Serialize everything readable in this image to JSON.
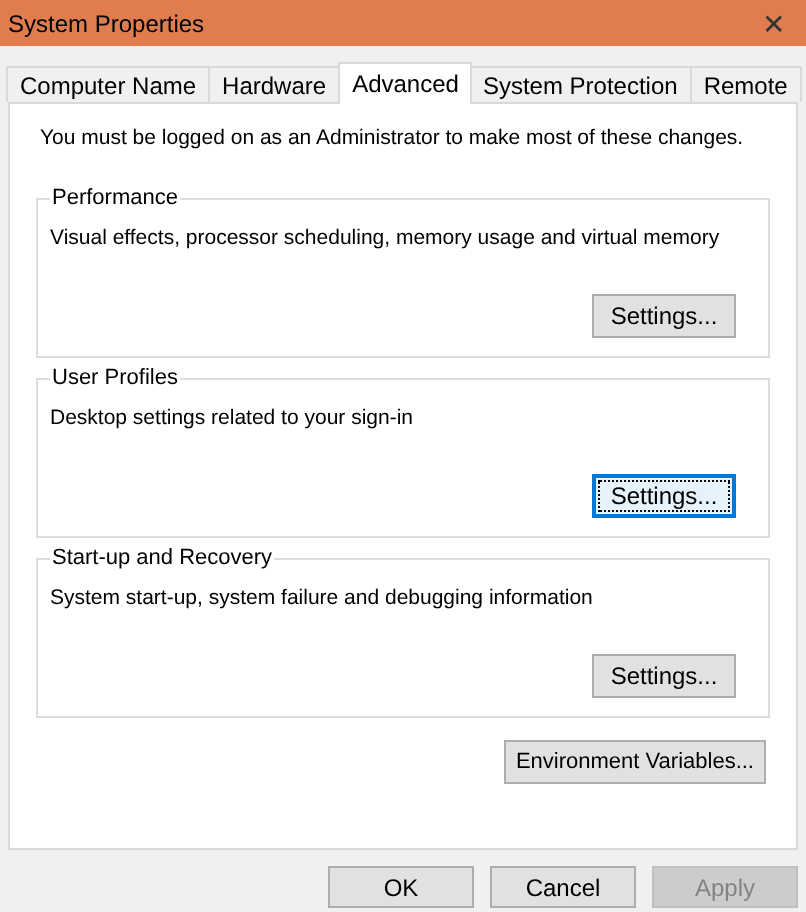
{
  "window": {
    "title": "System Properties",
    "close": "✕"
  },
  "tabs": [
    {
      "label": "Computer Name",
      "selected": false
    },
    {
      "label": "Hardware",
      "selected": false
    },
    {
      "label": "Advanced",
      "selected": true
    },
    {
      "label": "System Protection",
      "selected": false
    },
    {
      "label": "Remote",
      "selected": false
    }
  ],
  "notice": "You must be logged on as an Administrator to make most of these changes.",
  "groups": [
    {
      "title": "Performance",
      "description": "Visual effects, processor scheduling, memory usage and virtual memory",
      "button": "Settings...",
      "focused": false
    },
    {
      "title": "User Profiles",
      "description": "Desktop settings related to your sign-in",
      "button": "Settings...",
      "focused": true
    },
    {
      "title": "Start-up and Recovery",
      "description": "System start-up, system failure and debugging information",
      "button": "Settings...",
      "focused": false
    }
  ],
  "environment_button": "Environment Variables...",
  "buttons": [
    {
      "label": "OK",
      "disabled": false
    },
    {
      "label": "Cancel",
      "disabled": false
    },
    {
      "label": "Apply",
      "disabled": true
    }
  ]
}
